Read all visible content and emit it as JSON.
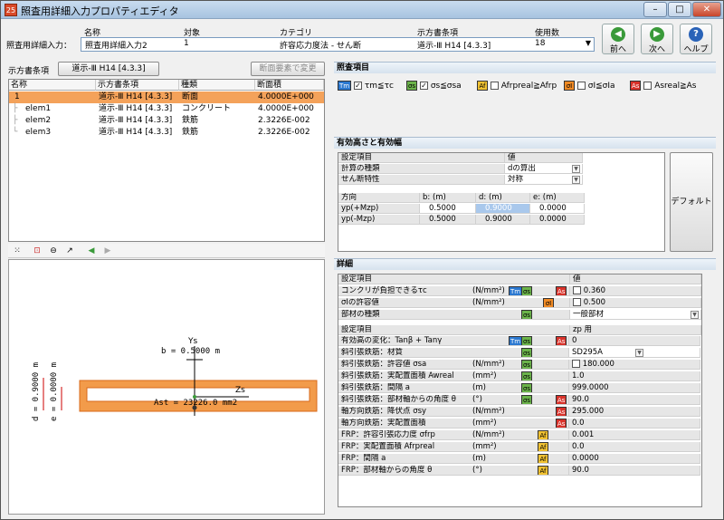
{
  "window": {
    "title": "照査用詳細入力プロパティエディタ",
    "app_icon": "25"
  },
  "header": {
    "cols": [
      "名称",
      "対象",
      "カテゴリ",
      "示方書条項",
      "使用数"
    ],
    "row_label": "照査用詳細入力：",
    "values": [
      "照査用詳細入力2",
      "1",
      "許容応力度法 - せん断",
      "道示-Ⅲ H14 [4.3.3]",
      "18"
    ]
  },
  "nav": {
    "prev": "前へ",
    "next": "次へ",
    "help": "ヘルプ"
  },
  "left": {
    "spec_label": "示方書条項",
    "spec_button": "道示-Ⅲ H14 [4.3.3]",
    "change_button": "断面要素で変更",
    "tree_cols": [
      "名称",
      "示方書条項",
      "種類",
      "断面積"
    ],
    "tree_rows": [
      {
        "name": "1",
        "spec": "道示-Ⅲ H14 [4.3.3]",
        "kind": "断面",
        "area": "4.0000E+000"
      },
      {
        "name": "elem1",
        "spec": "道示-Ⅲ H14 [4.3.3]",
        "kind": "コンクリート",
        "area": "4.0000E+000"
      },
      {
        "name": "elem2",
        "spec": "道示-Ⅲ H14 [4.3.3]",
        "kind": "鉄筋",
        "area": "2.3226E-002"
      },
      {
        "name": "elem3",
        "spec": "道示-Ⅲ H14 [4.3.3]",
        "kind": "鉄筋",
        "area": "2.3226E-002"
      }
    ],
    "canvas": {
      "ys": "Ys",
      "b": "b = 0.5000 m",
      "zs": "Zs",
      "ast": "Ast = 23226.0 mm2",
      "d": "d = 0.9000 m",
      "e": "e = 0.0000 m"
    }
  },
  "check_items": {
    "title": "照査項目",
    "items": [
      {
        "badge": "Tm",
        "badge_color": "#2b78d0",
        "checked": true,
        "label": "τm≦τc"
      },
      {
        "badge": "σs",
        "badge_color": "#6bb34a",
        "checked": true,
        "label": "σs≦σsa"
      },
      {
        "badge": "Af",
        "badge_color": "#f1c232",
        "checked": false,
        "label": "Afrpreal≧Afrp"
      },
      {
        "badge": "σI",
        "badge_color": "#f08a24",
        "checked": false,
        "label": "σI≦σIa"
      },
      {
        "badge": "As",
        "badge_color": "#d8322a",
        "checked": false,
        "label": "Asreal≧As"
      }
    ]
  },
  "eff_height": {
    "title": "有効高さと有効幅",
    "settings_header": [
      "設定項目",
      "値"
    ],
    "settings": [
      {
        "label": "計算の種類",
        "value": "dの算出"
      },
      {
        "label": "せん断特性",
        "value": "対称"
      }
    ],
    "dir_header": [
      "方向",
      "b: (m)",
      "d: (m)",
      "e: (m)"
    ],
    "dirs": [
      {
        "dir": "yp(+Mzp)",
        "b": "0.5000",
        "d": "0.9000",
        "e": "0.0000"
      },
      {
        "dir": "yp(-Mzp)",
        "b": "0.5000",
        "d": "0.9000",
        "e": "0.0000"
      }
    ],
    "default_button": "デフォルト"
  },
  "detail": {
    "title": "詳細",
    "top_header": [
      "設定項目",
      "値"
    ],
    "top_rows": [
      {
        "label": "コンクリが負担できるτc",
        "unit": "(N/mm²)",
        "badges": [
          "Tm",
          "σs",
          "As"
        ],
        "check": true,
        "value": "0.360"
      },
      {
        "label": "σIの許容値",
        "unit": "(N/mm²)",
        "badges": [
          "σI"
        ],
        "check": true,
        "value": "0.500"
      },
      {
        "label": "部材の種類",
        "unit": "",
        "badges": [
          "σs"
        ],
        "check": false,
        "value": "一般部材"
      }
    ],
    "bottom_header": [
      "設定項目",
      "zp 用"
    ],
    "bottom_rows": [
      {
        "label": "有効高の変化：Tanβ + Tanγ",
        "unit": "",
        "badges": [
          "Tm",
          "σs",
          "As"
        ],
        "check": false,
        "value": "0"
      },
      {
        "label": "斜引張鉄筋：材質",
        "unit": "",
        "badges": [
          "σs"
        ],
        "check": false,
        "value": "SD295A"
      },
      {
        "label": "斜引張鉄筋：許容値 σsa",
        "unit": "(N/mm²)",
        "badges": [
          "σs"
        ],
        "check": true,
        "value": "180.000"
      },
      {
        "label": "斜引張鉄筋：実配置面積 Awreal",
        "unit": "(mm²)",
        "badges": [
          "σs"
        ],
        "check": false,
        "value": "1.0"
      },
      {
        "label": "斜引張鉄筋：間隔 a",
        "unit": "(m)",
        "badges": [
          "σs"
        ],
        "check": false,
        "value": "999.0000"
      },
      {
        "label": "斜引張鉄筋：部材軸からの角度 θ",
        "unit": "(°)",
        "badges": [
          "σs",
          "As"
        ],
        "check": false,
        "value": "90.0"
      },
      {
        "label": "軸方向鉄筋：降伏点 σsy",
        "unit": "(N/mm²)",
        "badges": [
          "As"
        ],
        "check": false,
        "value": "295.000"
      },
      {
        "label": "軸方向鉄筋：実配置面積",
        "unit": "(mm²)",
        "badges": [
          "As"
        ],
        "check": false,
        "value": "0.0"
      },
      {
        "label": "FRP：許容引張応力度 σfrp",
        "unit": "(N/mm²)",
        "badges": [
          "Af"
        ],
        "check": false,
        "value": "0.001"
      },
      {
        "label": "FRP：実配置面積 Afrpreal",
        "unit": "(mm²)",
        "badges": [
          "Af"
        ],
        "check": false,
        "value": "0.0"
      },
      {
        "label": "FRP：間隔 a",
        "unit": "(m)",
        "badges": [
          "Af"
        ],
        "check": false,
        "value": "0.0000"
      },
      {
        "label": "FRP：部材軸からの角度 θ",
        "unit": "(°)",
        "badges": [
          "Af"
        ],
        "check": false,
        "value": "90.0"
      }
    ]
  }
}
